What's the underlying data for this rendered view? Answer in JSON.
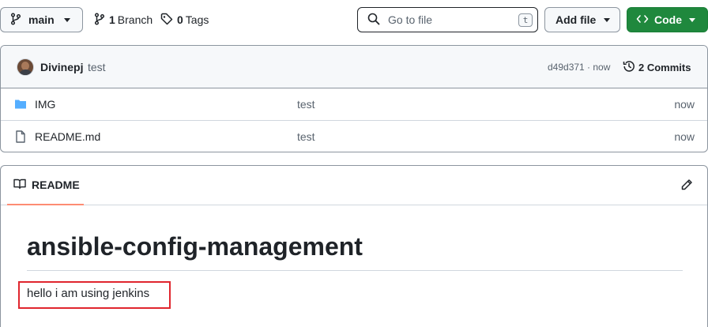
{
  "toolbar": {
    "branch_label": "main",
    "branches_count": "1",
    "branches_word": "Branch",
    "tags_count": "0",
    "tags_word": "Tags",
    "search_placeholder": "Go to file",
    "search_shortcut": "t",
    "add_file_label": "Add file",
    "code_label": "Code"
  },
  "commit": {
    "author": "Divinepj",
    "message": "test",
    "hash_time": "d49d371 · now",
    "commits_label": "2 Commits"
  },
  "files": [
    {
      "name": "IMG",
      "type": "folder",
      "message": "test",
      "age": "now"
    },
    {
      "name": "README.md",
      "type": "file",
      "message": "test",
      "age": "now"
    }
  ],
  "readme": {
    "tab_label": "README",
    "heading": "ansible-config-management",
    "paragraph": "hello i am using jenkins"
  },
  "colors": {
    "code_button": "#1f883d",
    "folder_icon": "#54aeff",
    "tab_underline": "#fd8c73",
    "highlight_box": "#e0262e"
  }
}
